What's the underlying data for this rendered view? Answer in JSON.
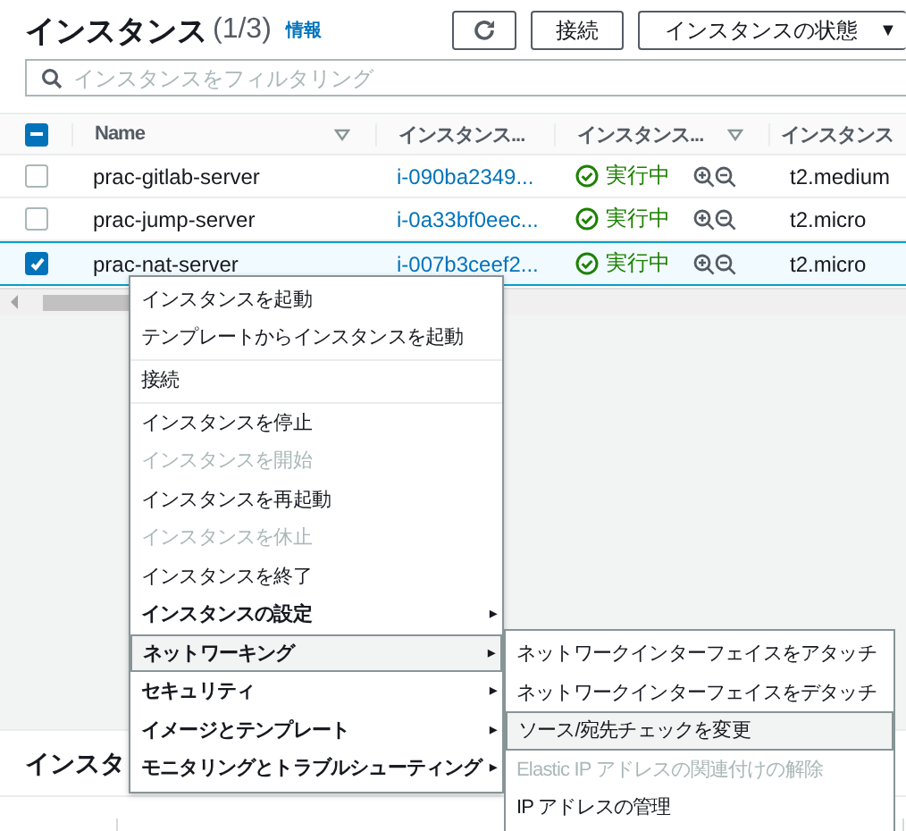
{
  "header": {
    "title": "インスタンス",
    "count": "(1/3)",
    "info_link": "情報",
    "buttons": [
      {
        "kind": "refresh"
      },
      {
        "kind": "text",
        "label": "接続"
      },
      {
        "kind": "dropdown",
        "label": "インスタンスの状態",
        "caret": "▼"
      }
    ]
  },
  "search": {
    "placeholder": "インスタンスをフィルタリング"
  },
  "table": {
    "header_checkbox": {
      "indeterminate": true
    },
    "columns": [
      {
        "label": "Name",
        "filter": true
      },
      {
        "label": "インスタンス...",
        "filter": false
      },
      {
        "label": "インスタンス...",
        "filter": true
      },
      {
        "label": "インスタンス",
        "filter": false
      }
    ],
    "rows": [
      {
        "name": "prac-gitlab-server",
        "instance_id": "i-090ba2349...",
        "status": "実行中",
        "type": "t2.medium",
        "selected": false
      },
      {
        "name": "prac-jump-server",
        "instance_id": "i-0a33bf0eec...",
        "status": "実行中",
        "type": "t2.micro",
        "selected": false
      },
      {
        "name": "prac-nat-server",
        "instance_id": "i-007b3ceef2...",
        "status": "実行中",
        "type": "t2.micro",
        "selected": true
      }
    ]
  },
  "lower_panel": {
    "title": "インスタ"
  },
  "menu": {
    "items": [
      {
        "label": "インスタンスを起動",
        "kind": "action",
        "disabled": false,
        "selected": false,
        "separator_after": false
      },
      {
        "label": "テンプレートからインスタンスを起動",
        "kind": "action",
        "disabled": false,
        "selected": false,
        "separator_after": true
      },
      {
        "label": "接続",
        "kind": "action",
        "disabled": false,
        "selected": false,
        "separator_after": true
      },
      {
        "label": "インスタンスを停止",
        "kind": "action",
        "disabled": false,
        "selected": false,
        "separator_after": false
      },
      {
        "label": "インスタンスを開始",
        "kind": "action",
        "disabled": true,
        "selected": false,
        "separator_after": false
      },
      {
        "label": "インスタンスを再起動",
        "kind": "action",
        "disabled": false,
        "selected": false,
        "separator_after": false
      },
      {
        "label": "インスタンスを休止",
        "kind": "action",
        "disabled": true,
        "selected": false,
        "separator_after": false
      },
      {
        "label": "インスタンスを終了",
        "kind": "action",
        "disabled": false,
        "selected": false,
        "separator_after": false
      },
      {
        "label": "インスタンスの設定",
        "kind": "submenu",
        "disabled": false,
        "selected": false,
        "separator_after": false
      },
      {
        "label": "ネットワーキング",
        "kind": "submenu",
        "disabled": false,
        "selected": true,
        "separator_after": false
      },
      {
        "label": "セキュリティ",
        "kind": "submenu",
        "disabled": false,
        "selected": false,
        "separator_after": false
      },
      {
        "label": "イメージとテンプレート",
        "kind": "submenu",
        "disabled": false,
        "selected": false,
        "separator_after": false
      },
      {
        "label": "モニタリングとトラブルシューティング",
        "kind": "submenu",
        "disabled": false,
        "selected": false,
        "separator_after": false
      }
    ],
    "arrow": "▸",
    "submenu": [
      {
        "label": "ネットワークインターフェイスをアタッチ",
        "disabled": false,
        "selected": false
      },
      {
        "label": "ネットワークインターフェイスをデタッチ",
        "disabled": false,
        "selected": false
      },
      {
        "label": "ソース/宛先チェックを変更",
        "disabled": false,
        "selected": true
      },
      {
        "label": "Elastic IP アドレスの関連付けの解除",
        "disabled": true,
        "selected": false
      },
      {
        "label": "IP アドレスの管理",
        "disabled": false,
        "selected": false
      }
    ]
  }
}
